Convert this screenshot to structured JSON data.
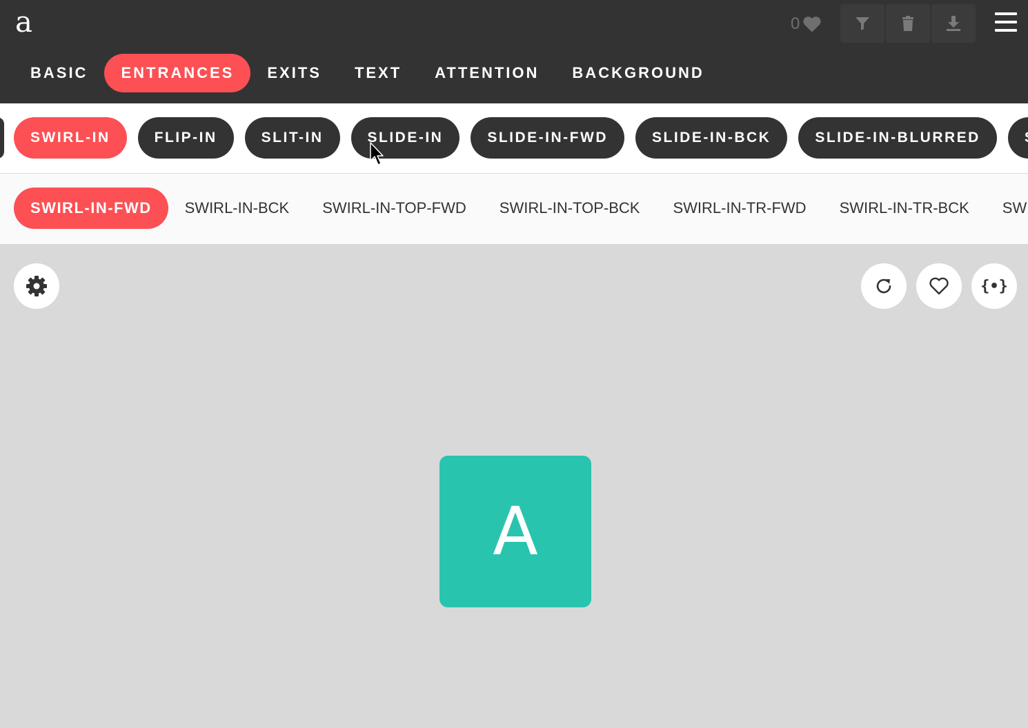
{
  "header": {
    "logo": "a",
    "favorites_count": "0",
    "icons": [
      "heart-icon",
      "filter-icon",
      "trash-icon",
      "download-icon",
      "menu-icon"
    ]
  },
  "main_tabs": [
    {
      "label": "BASIC",
      "active": false
    },
    {
      "label": "ENTRANCES",
      "active": true
    },
    {
      "label": "EXITS",
      "active": false
    },
    {
      "label": "TEXT",
      "active": false
    },
    {
      "label": "ATTENTION",
      "active": false
    },
    {
      "label": "BACKGROUND",
      "active": false
    }
  ],
  "sub_categories": [
    {
      "label": "SWIRL-IN",
      "active": true
    },
    {
      "label": "FLIP-IN",
      "active": false
    },
    {
      "label": "SLIT-IN",
      "active": false
    },
    {
      "label": "SLIDE-IN",
      "active": false
    },
    {
      "label": "SLIDE-IN-FWD",
      "active": false
    },
    {
      "label": "SLIDE-IN-BCK",
      "active": false
    },
    {
      "label": "SLIDE-IN-BLURRED",
      "active": false
    },
    {
      "label": "SLIDE-IN-ELLIPTIC",
      "active": false
    }
  ],
  "variants": [
    {
      "label": "SWIRL-IN-FWD",
      "active": true
    },
    {
      "label": "SWIRL-IN-BCK",
      "active": false
    },
    {
      "label": "SWIRL-IN-TOP-FWD",
      "active": false
    },
    {
      "label": "SWIRL-IN-TOP-BCK",
      "active": false
    },
    {
      "label": "SWIRL-IN-TR-FWD",
      "active": false
    },
    {
      "label": "SWIRL-IN-TR-BCK",
      "active": false
    },
    {
      "label": "SWIRL-IN-RIGHT-FWD",
      "active": false
    }
  ],
  "stage": {
    "demo_letter": "A",
    "code_button_label": "{•}",
    "icons": [
      "gear-icon",
      "replay-icon",
      "heart-outline-icon",
      "code-icon"
    ]
  },
  "colors": {
    "header_bg": "#333333",
    "accent": "#fc5054",
    "demo_box": "#29c4ae",
    "stage_bg": "#d9d9d9"
  }
}
